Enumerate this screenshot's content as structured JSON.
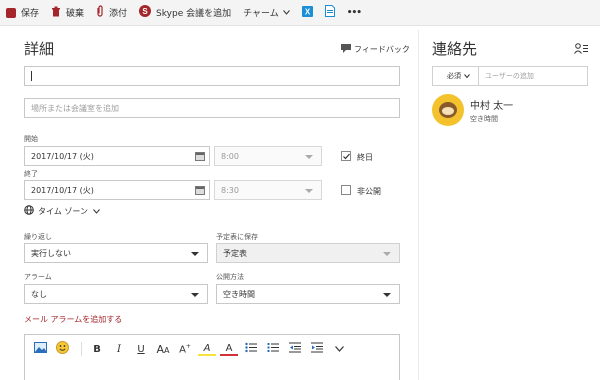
{
  "toolbar": {
    "save": "保存",
    "discard": "破棄",
    "attach": "添付",
    "skype": "Skype 会議を追加",
    "charm": "チャーム",
    "more": "•••"
  },
  "details": {
    "title": "詳細",
    "feedback": "フィードバック",
    "event_title_value": "",
    "location_placeholder": "場所または会議室を追加",
    "start_label": "開始",
    "start_date": "2017/10/17 (火)",
    "start_time": "8:00",
    "end_label": "終了",
    "end_date": "2017/10/17 (火)",
    "end_time": "8:30",
    "all_day": "終日",
    "private": "非公開",
    "timezone": "タイム ゾーン",
    "repeat_label": "繰り返し",
    "repeat_value": "実行しない",
    "save_to_label": "予定表に保存",
    "save_to_value": "予定表",
    "alarm_label": "アラーム",
    "alarm_value": "なし",
    "show_as_label": "公開方法",
    "show_as_value": "空き時間",
    "add_email_alarm": "メール アラームを追加する"
  },
  "editor": {
    "tools": [
      "B",
      "I",
      "U",
      "A",
      "A",
      "A",
      "A"
    ]
  },
  "contacts": {
    "title": "連絡先",
    "required": "必須",
    "add_user_placeholder": "ユーザーの追加",
    "person": {
      "name": "中村 太一",
      "status": "空き時間"
    }
  },
  "colors": {
    "accent_red": "#a4262c",
    "skype_blue": "#1a8fd6",
    "avatar_bg": "#f3c22d"
  }
}
